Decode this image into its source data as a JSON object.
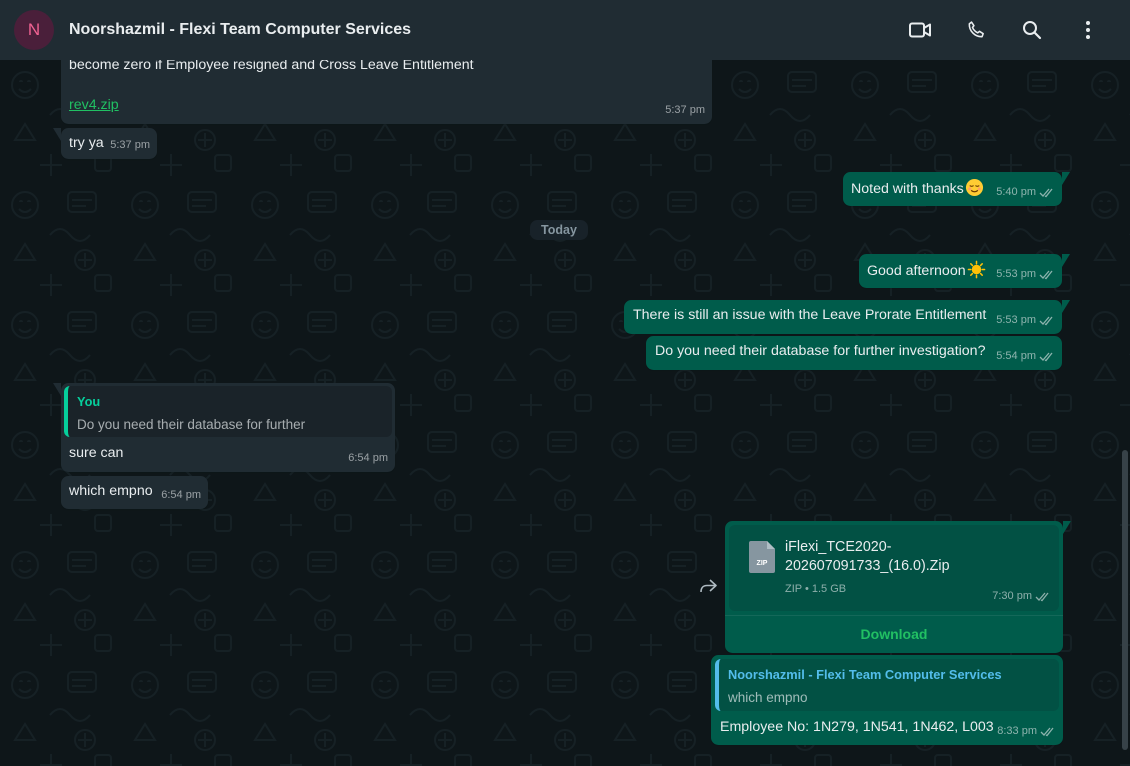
{
  "header": {
    "avatar_letter": "N",
    "title": "Noorshazmil - Flexi Team Computer Services",
    "icons": [
      "video-call-icon",
      "voice-call-icon",
      "search-icon",
      "menu-icon"
    ]
  },
  "date_divider": "Today",
  "messages": [
    {
      "dir": "in",
      "text": "become zero if Employee resigned and Cross Leave Entitlement",
      "link": "rev4.zip",
      "time": "5:37 pm"
    },
    {
      "dir": "in",
      "text": "try ya",
      "time": "5:37 pm"
    },
    {
      "dir": "out",
      "text": "Noted with thanks",
      "emoji": "relieved-face",
      "time": "5:40 pm"
    },
    {
      "dir": "out",
      "text": "Good afternoon",
      "emoji": "sun",
      "time": "5:53 pm"
    },
    {
      "dir": "out",
      "text": "There is still an issue with the Leave Prorate Entitlement",
      "time": "5:53 pm"
    },
    {
      "dir": "out",
      "text": "Do you need their database for further investigation?",
      "time": "5:54 pm"
    },
    {
      "dir": "in",
      "quote": {
        "name": "You",
        "text": "Do you need their database for further investigation?"
      },
      "text": "sure can",
      "time": "6:54 pm"
    },
    {
      "dir": "in",
      "text": "which empno",
      "time": "6:54 pm"
    },
    {
      "dir": "out",
      "file": {
        "name_line1": "iFlexi_TCE2020-",
        "name_line2": "202607091733_(16.0).Zip",
        "meta": "ZIP • 1.5 GB",
        "icon_label": "ZIP"
      },
      "action": "Download",
      "time": "7:30 pm"
    },
    {
      "dir": "out",
      "quote": {
        "name": "Noorshazmil - Flexi Team Computer Services",
        "text": "which empno"
      },
      "text": "Employee No: 1N279, 1N541, 1N462, L003",
      "time": "8:33 pm"
    }
  ],
  "colors": {
    "header_bg": "#202c33",
    "chat_bg": "#0b141a",
    "bubble_in": "#202c33",
    "bubble_out": "#005c4b",
    "accent_green": "#06cf9c",
    "accent_blue": "#53bdeb",
    "link_green": "#21c063"
  }
}
